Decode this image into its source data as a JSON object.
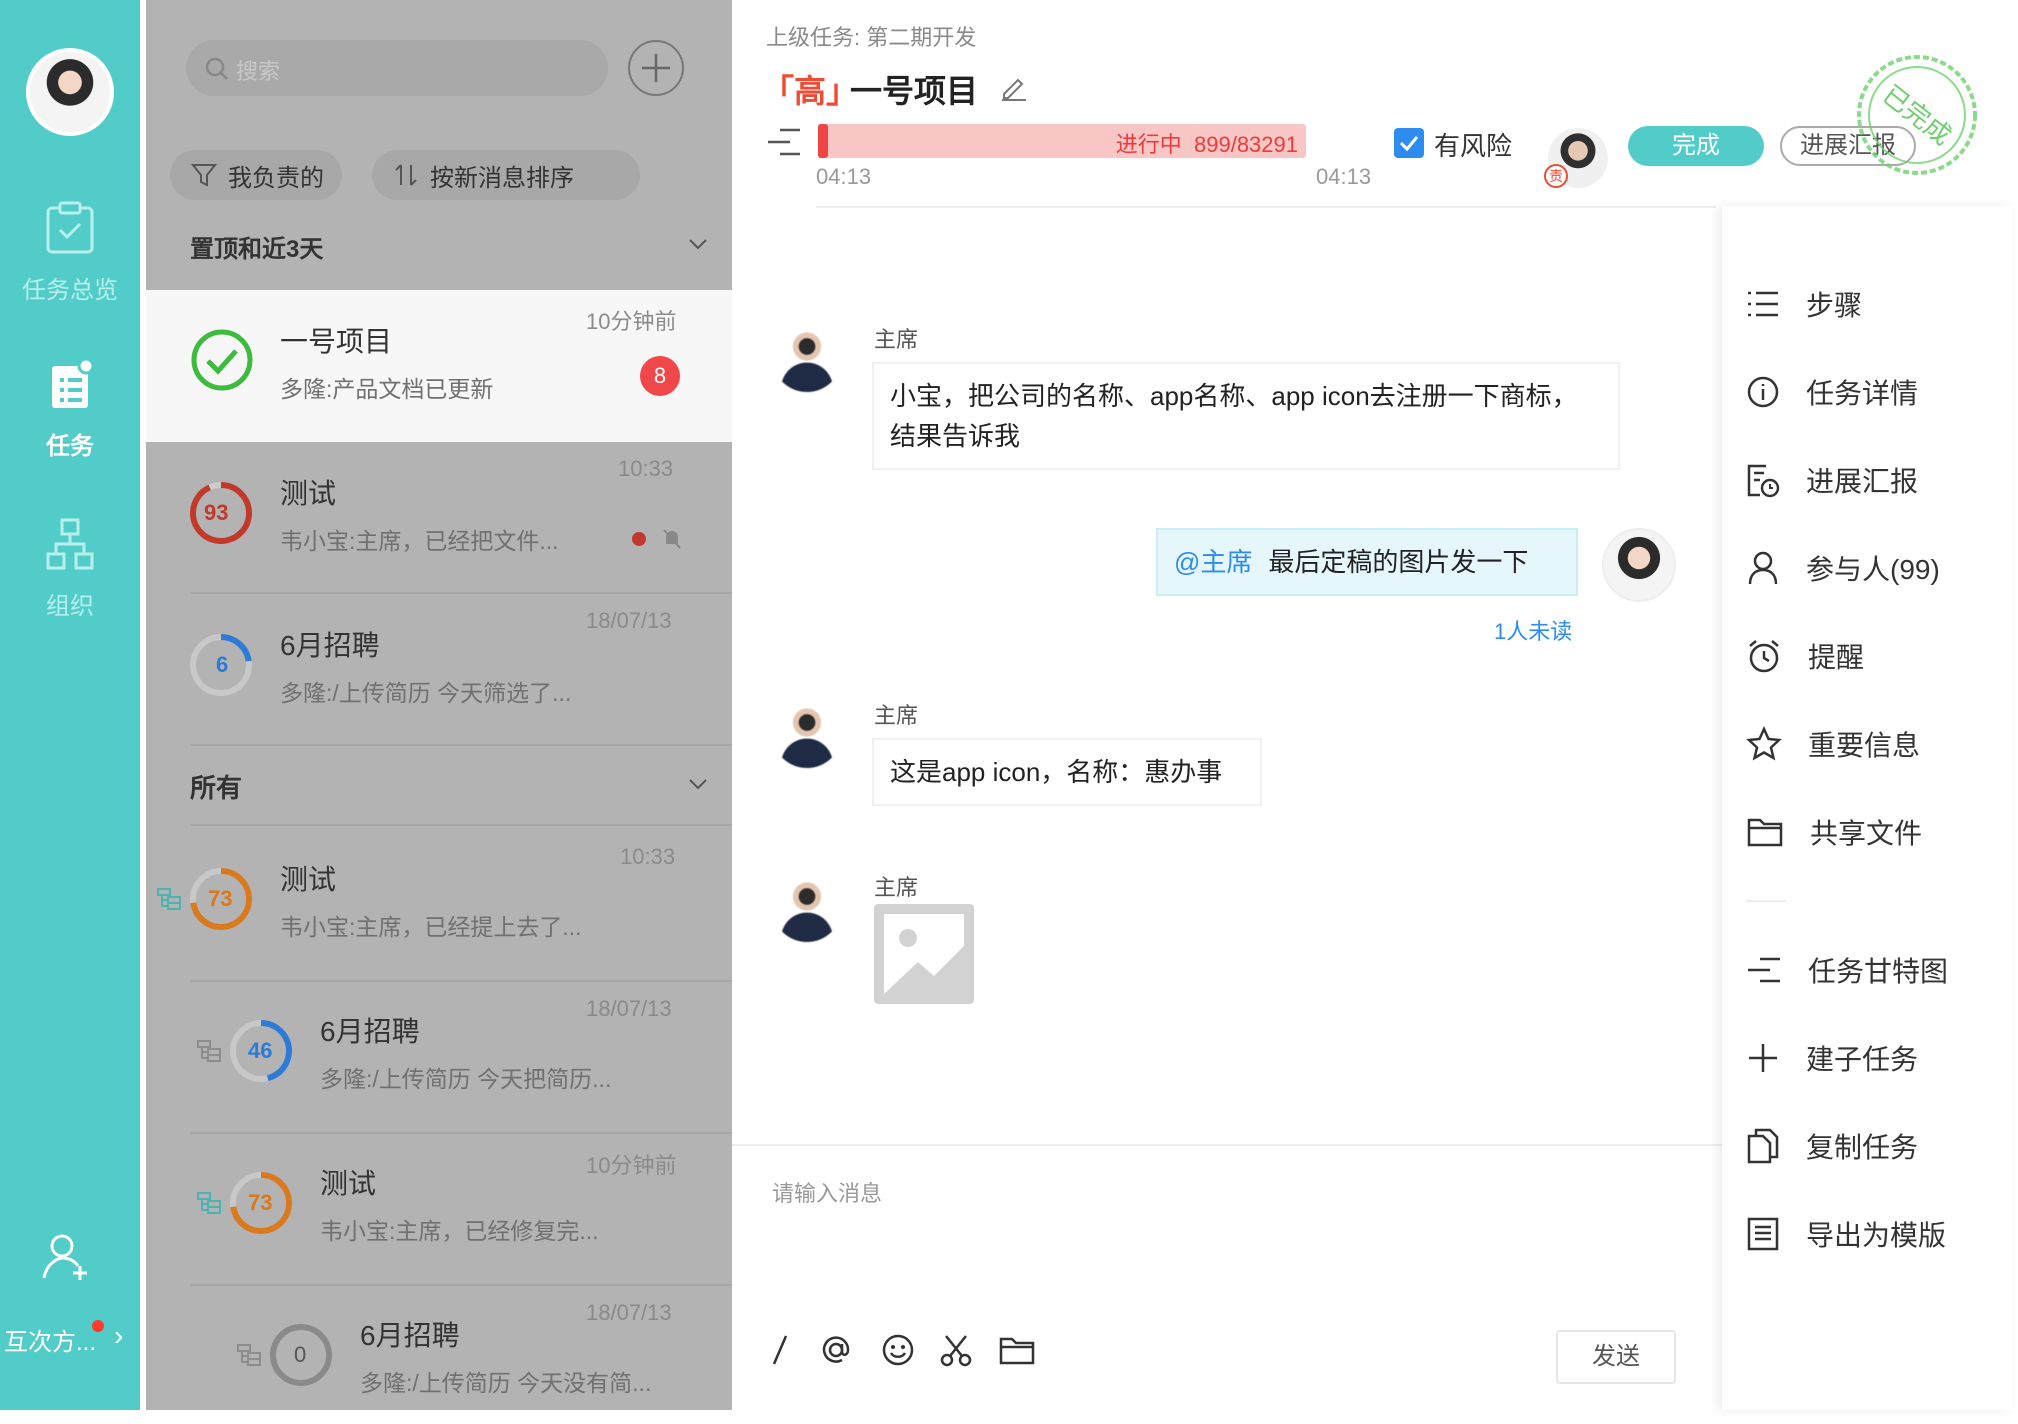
{
  "nav": {
    "items": [
      {
        "label": "任务总览"
      },
      {
        "label": "任务"
      },
      {
        "label": "组织"
      }
    ],
    "party": "互次方..."
  },
  "list": {
    "search_placeholder": "搜索",
    "filters": [
      "我负责的",
      "按新消息排序"
    ],
    "group_pinned": "置顶和近3天",
    "group_all": "所有",
    "items": [
      {
        "title": "一号项目",
        "sub": "多隆:产品文档已更新",
        "time": "10分钟前",
        "badge": "8"
      },
      {
        "title": "测试",
        "sub": "韦小宝:主席，已经把文件...",
        "time": "10:33",
        "progress": "93"
      },
      {
        "title": "6月招聘",
        "sub": "多隆:/上传简历 今天筛选了...",
        "time": "18/07/13",
        "progress": "6"
      },
      {
        "title": "测试",
        "sub": "韦小宝:主席，已经提上去了...",
        "time": "10:33",
        "progress": "73"
      },
      {
        "title": "6月招聘",
        "sub": "多隆:/上传简历 今天把简历...",
        "time": "18/07/13",
        "progress": "46"
      },
      {
        "title": "测试",
        "sub": "韦小宝:主席，已经修复完...",
        "time": "10分钟前",
        "progress": "73"
      },
      {
        "title": "6月招聘",
        "sub": "多隆:/上传简历 今天没有简...",
        "time": "18/07/13",
        "progress": "0"
      }
    ]
  },
  "task": {
    "parent": "上级任务:  第二期开发",
    "priority": "「高」",
    "title": "一号项目",
    "status": "进行中",
    "progress_text": "899/83291",
    "progress_fraction": 0.011,
    "start_time": "04:13",
    "end_time": "04:13",
    "risk_label": "有风险",
    "owner_tag": "责",
    "done_label": "完成",
    "report_label": "进展汇报",
    "stamp_text": "已完成"
  },
  "messages": [
    {
      "name": "主席",
      "text": "小宝，把公司的名称、app名称、app icon去注册一下商标，结果告诉我"
    },
    {
      "mention": "@主席",
      "text": "最后定稿的图片发一下",
      "unread": "1人未读"
    },
    {
      "name": "主席",
      "text": "这是app icon，名称：惠办事"
    },
    {
      "name": "主席"
    }
  ],
  "composer": {
    "placeholder": "请输入消息",
    "send_label": "发送"
  },
  "side_menu": {
    "items": [
      "步骤",
      "任务详情",
      "进展汇报",
      "参与人(99)",
      "提醒",
      "重要信息",
      "共享文件"
    ],
    "items2": [
      "任务甘特图",
      "建子任务",
      "复制任务",
      "导出为模版"
    ]
  },
  "colors": {
    "brand": "#52ccc9",
    "danger": "#ef4545",
    "link": "#2d8cf0"
  }
}
